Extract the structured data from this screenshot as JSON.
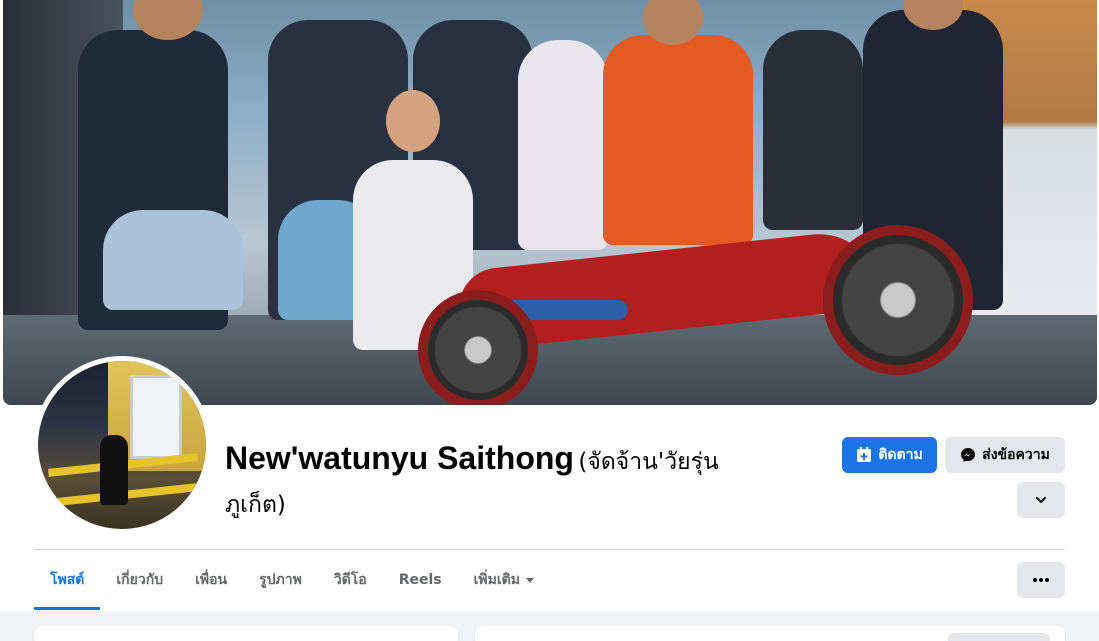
{
  "profile": {
    "name": "New'watunyu Saithong",
    "alternate_name": "(จัดจ้าน'วัยรุ่น ภูเก็ต)"
  },
  "actions": {
    "follow_label": "ติดตาม",
    "message_label": "ส่งข้อความ",
    "follow_icon": "follow-icon",
    "message_icon": "messenger-icon"
  },
  "tabs": [
    {
      "label": "โพสต์",
      "active": true
    },
    {
      "label": "เกี่ยวกับ",
      "active": false
    },
    {
      "label": "เพื่อน",
      "active": false
    },
    {
      "label": "รูปภาพ",
      "active": false
    },
    {
      "label": "วิดีโอ",
      "active": false
    },
    {
      "label": "Reels",
      "active": false
    },
    {
      "label": "เพิ่มเติม",
      "active": false
    }
  ],
  "colors": {
    "accent": "#1b74e4",
    "secondary_button": "#e4e6eb",
    "page_background": "#f0f2f5"
  }
}
